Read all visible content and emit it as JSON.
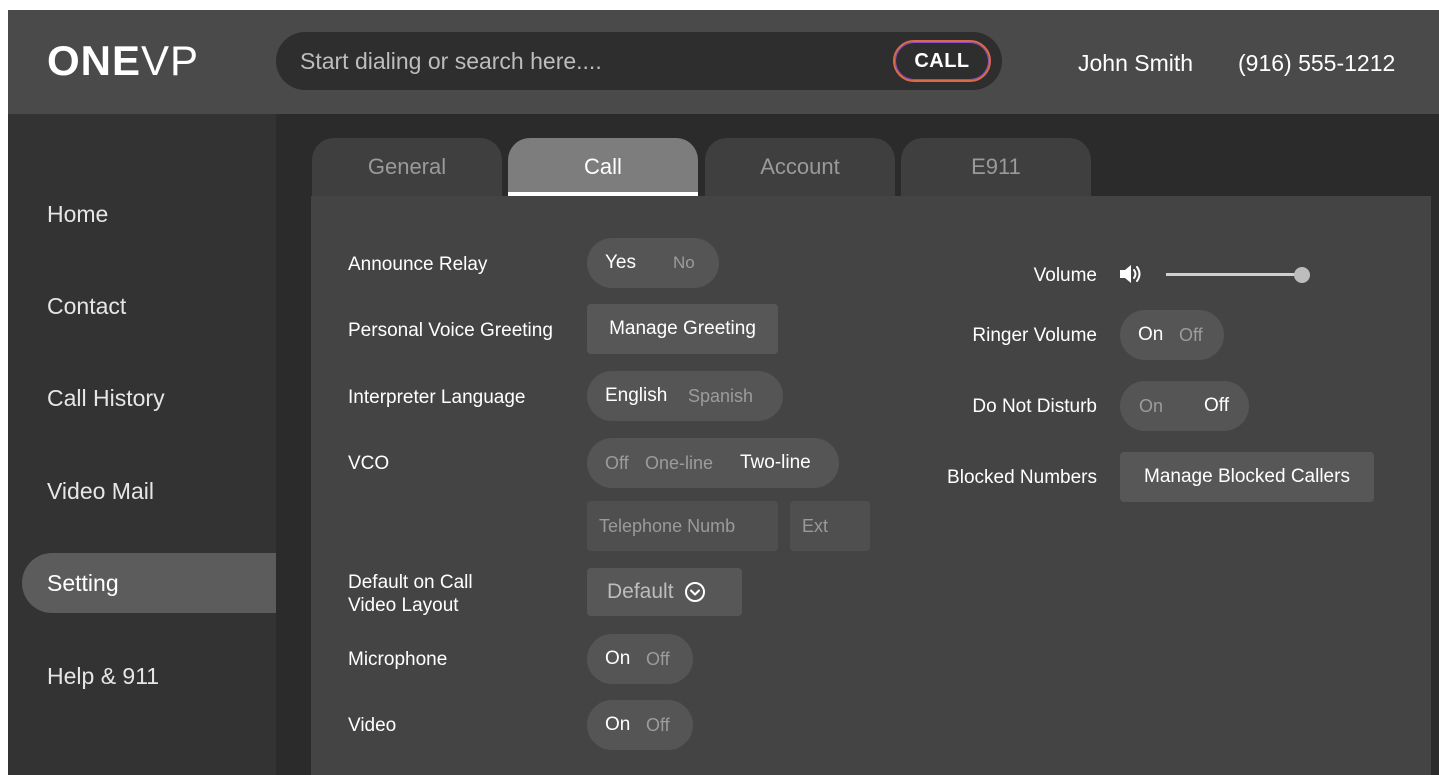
{
  "header": {
    "logo_bold": "ONE",
    "logo_thin": "VP",
    "search_placeholder": "Start dialing or search here....",
    "call_label": "CALL",
    "user_name": "John Smith",
    "user_phone": "(916) 555-1212"
  },
  "sidebar": {
    "items": [
      {
        "label": "Home"
      },
      {
        "label": "Contact"
      },
      {
        "label": "Call History"
      },
      {
        "label": "Video Mail"
      },
      {
        "label": "Setting",
        "active": true
      },
      {
        "label": "Help & 911"
      }
    ]
  },
  "tabs": [
    {
      "label": "General"
    },
    {
      "label": "Call",
      "active": true
    },
    {
      "label": "Account"
    },
    {
      "label": "E911"
    }
  ],
  "settings": {
    "announce_relay": {
      "label": "Announce Relay",
      "options": [
        "Yes",
        "No"
      ],
      "selected": "Yes"
    },
    "voice_greeting": {
      "label": "Personal Voice Greeting",
      "button": "Manage Greeting"
    },
    "interpreter_language": {
      "label": "Interpreter Language",
      "options": [
        "English",
        "Spanish"
      ],
      "selected": "English"
    },
    "vco": {
      "label": "VCO",
      "options": [
        "Off",
        "One-line",
        "Two-line"
      ],
      "selected": "Two-line",
      "phone_placeholder": "Telephone Numb",
      "ext_placeholder": "Ext"
    },
    "video_layout": {
      "label_line1": "Default on Call",
      "label_line2": "Video Layout",
      "value": "Default"
    },
    "microphone": {
      "label": "Microphone",
      "options": [
        "On",
        "Off"
      ],
      "selected": "On"
    },
    "video": {
      "label": "Video",
      "options": [
        "On",
        "Off"
      ],
      "selected": "On"
    },
    "volume": {
      "label": "Volume",
      "level": 1.0
    },
    "ringer_volume": {
      "label": "Ringer Volume",
      "options": [
        "On",
        "Off"
      ],
      "selected": "On"
    },
    "do_not_disturb": {
      "label": "Do Not Disturb",
      "options": [
        "On",
        "Off"
      ],
      "selected": "Off"
    },
    "blocked_numbers": {
      "label": "Blocked Numbers",
      "button": "Manage Blocked Callers"
    }
  },
  "colors": {
    "header_bg": "#4a4a4a",
    "sidebar_bg": "#333333",
    "panel_bg": "#444444",
    "active_tab": "#7d7d7d",
    "call_button_gradient_start": "#8b4fc9",
    "call_button_gradient_end": "#d96a4a"
  },
  "icons": [
    "speaker-icon",
    "chevron-down-circle-icon"
  ]
}
